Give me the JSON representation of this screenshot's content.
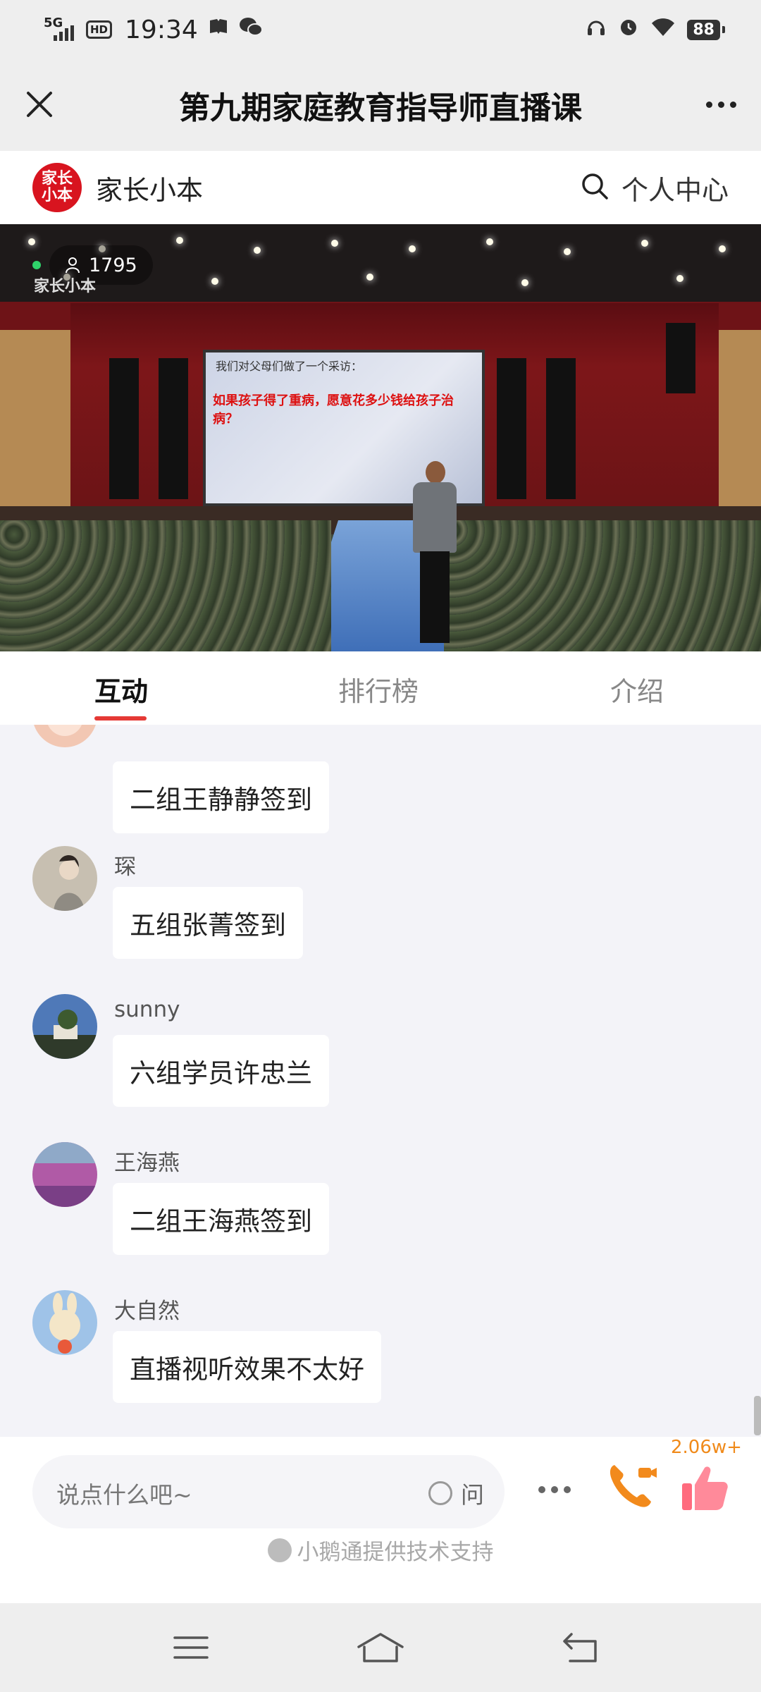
{
  "status_bar": {
    "network": "5G",
    "hd": "HD",
    "time": "19:34",
    "battery": "88"
  },
  "title_bar": {
    "title": "第九期家庭教育指导师直播课"
  },
  "shop": {
    "logo_text": "家长小本",
    "name": "家长小本",
    "personal_center": "个人中心"
  },
  "video": {
    "viewer_count": "1795",
    "watermark": "家长小本",
    "screen_line1": "我们对父母们做了一个采访：",
    "screen_red": "如果孩子得了重病，愿意花多少钱给孩子治病？"
  },
  "tabs": [
    {
      "label": "互动",
      "active": true
    },
    {
      "label": "排行榜",
      "active": false
    },
    {
      "label": "介绍",
      "active": false
    }
  ],
  "messages": [
    {
      "name": "",
      "text": "二组王静静签到",
      "avatar_color": "#f2c7b3"
    },
    {
      "name": "琛",
      "text": "五组张菁签到",
      "avatar_color": "#c7bfb1"
    },
    {
      "name": "sunny",
      "text": "六组学员许忠兰",
      "avatar_color": "#4f79b8"
    },
    {
      "name": "王海燕",
      "text": "二组王海燕签到",
      "avatar_color": "#b05aa6"
    },
    {
      "name": "大自然",
      "text": "直播视听效果不太好",
      "avatar_color": "#9fc3e8"
    }
  ],
  "input": {
    "placeholder": "说点什么吧~",
    "ask_label": "问",
    "like_count": "2.06w+"
  },
  "support_text": "小鹅通提供技术支持",
  "colors": {
    "accent_red": "#e53935",
    "like_orange": "#f08a1a"
  }
}
